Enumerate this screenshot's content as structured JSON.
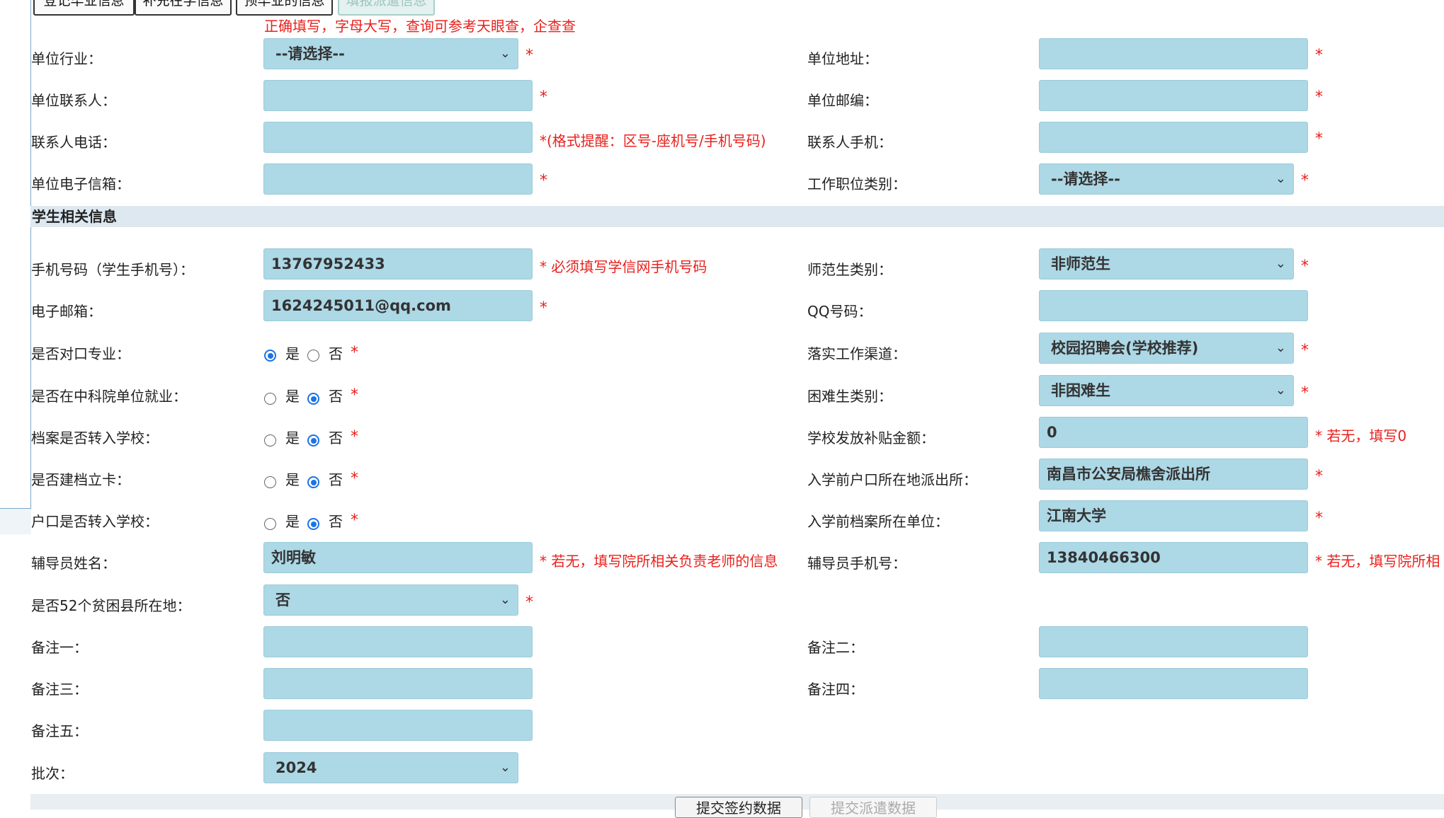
{
  "tabs": [
    {
      "label": "登记毕业信息",
      "disabled": false
    },
    {
      "label": "补充在学信息",
      "disabled": false
    },
    {
      "label": "预毕业的信息",
      "disabled": false
    },
    {
      "label": "填报派遣信息",
      "disabled": true
    }
  ],
  "top_hint": "正确填写，字母大写，查询可参考天眼查，企查查",
  "star": "*",
  "employer": {
    "industry_label": "单位行业：",
    "industry_value": "--请选择--",
    "address_label": "单位地址：",
    "address_value": "",
    "contact_label": "单位联系人：",
    "contact_value": "",
    "postcode_label": "单位邮编：",
    "postcode_value": "",
    "phone_label": "联系人电话：",
    "phone_value": "",
    "phone_hint": "*(格式提醒：区号-座机号/手机号码)",
    "mobile_label": "联系人手机：",
    "mobile_value": "",
    "email_label": "单位电子信箱：",
    "email_value": "",
    "job_category_label": "工作职位类别：",
    "job_category_value": "--请选择--"
  },
  "section_title": "学生相关信息",
  "student": {
    "mobile_label": "手机号码（学生手机号）：",
    "mobile_value": "13767952433",
    "mobile_hint": "* 必须填写学信网手机号码",
    "normal_label": "师范生类别：",
    "normal_value": "非师范生",
    "email_label": "电子邮箱：",
    "email_value": "1624245011@qq.com",
    "qq_label": "QQ号码：",
    "qq_value": "",
    "match_label": "是否对口专业：",
    "channel_label": "落实工作渠道：",
    "channel_value": "校园招聘会(学校推荐)",
    "cas_label": "是否在中科院单位就业：",
    "hardship_label": "困难生类别：",
    "hardship_value": "非困难生",
    "archive_label": "档案是否转入学校：",
    "subsidy_label": "学校发放补贴金额：",
    "subsidy_value": "0",
    "subsidy_hint": "* 若无，填写0",
    "card_label": "是否建档立卡：",
    "police_label": "入学前户口所在地派出所：",
    "police_value": "南昌市公安局樵舍派出所",
    "hukou_label": "户口是否转入学校：",
    "archive_unit_label": "入学前档案所在单位：",
    "archive_unit_value": "江南大学",
    "counselor_label": "辅导员姓名：",
    "counselor_value": "刘明敏",
    "counselor_hint": "* 若无，填写院所相关负责老师的信息",
    "counselor_phone_label": "辅导员手机号：",
    "counselor_phone_value": "13840466300",
    "counselor_phone_hint": "* 若无，填写院所相",
    "poor_county_label": "是否52个贫困县所在地：",
    "poor_county_value": "否",
    "note1_label": "备注一：",
    "note2_label": "备注二：",
    "note3_label": "备注三：",
    "note4_label": "备注四：",
    "note5_label": "备注五：",
    "batch_label": "批次：",
    "batch_value": "2024"
  },
  "radio": {
    "yes": "是",
    "no": "否"
  },
  "radios": {
    "match": "yes",
    "cas": "no",
    "archive": "no",
    "card": "no",
    "hukou": "no"
  },
  "buttons": {
    "submit_contract": "提交签约数据",
    "submit_dispatch": "提交派遣数据"
  }
}
